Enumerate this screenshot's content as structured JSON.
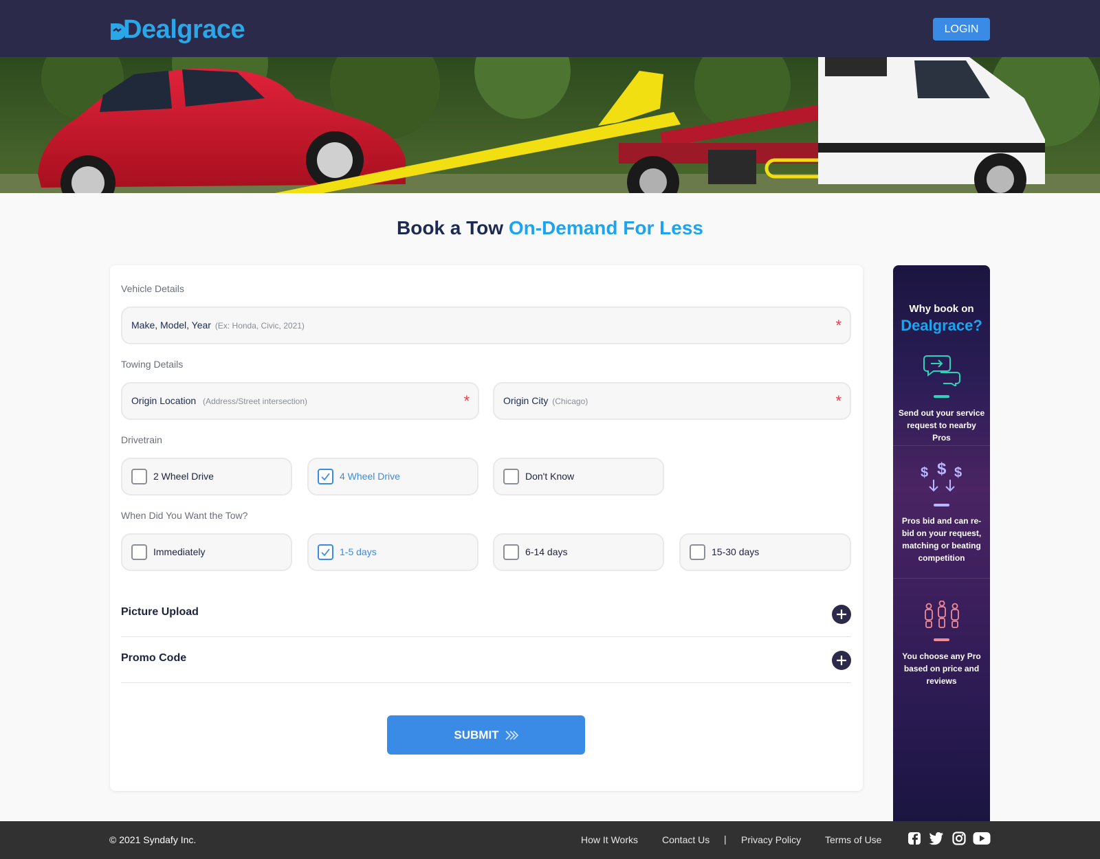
{
  "header": {
    "logo_text": "Dealgrace",
    "login_label": "LOGIN"
  },
  "hero": {
    "image": "tow-truck-loading-red-car"
  },
  "title": {
    "part1": "Book a Tow ",
    "part2": "On-Demand For Less"
  },
  "form": {
    "vehicle_section": "Vehicle Details",
    "vehicle_field": {
      "label": "Make, Model, Year",
      "placeholder": "(Ex: Honda, Civic, 2021)",
      "required": "*"
    },
    "towing_section": "Towing Details",
    "origin_location": {
      "label": "Origin Location",
      "placeholder": "(Address/Street intersection)",
      "required": "*"
    },
    "origin_city": {
      "label": "Origin City",
      "placeholder": "(Chicago)",
      "required": "*"
    },
    "drivetrain_section": "Drivetrain",
    "drivetrain_options": [
      {
        "label": "2 Wheel Drive",
        "checked": false
      },
      {
        "label": "4 Wheel Drive",
        "checked": true
      },
      {
        "label": "Don't Know",
        "checked": false
      }
    ],
    "when_section": "When Did You Want the Tow?",
    "when_options": [
      {
        "label": "Immediately",
        "checked": false
      },
      {
        "label": "1-5 days",
        "checked": true
      },
      {
        "label": "6-14 days",
        "checked": false
      },
      {
        "label": "15-30 days",
        "checked": false
      }
    ],
    "picture_upload": "Picture Upload",
    "promo_code": "Promo Code",
    "submit_label": "SUBMIT"
  },
  "why": {
    "heading1": "Why book on",
    "heading2": "Dealgrace?",
    "steps": [
      {
        "text": "Send out your service request to nearby Pros",
        "icon": "chat-bubbles-icon",
        "color": "#2ed3b7"
      },
      {
        "text": "Pros bid and can re-bid on your request, matching or beating competition",
        "icon": "dollar-bids-icon",
        "color": "#b9b7ff"
      },
      {
        "text": "You choose any Pro based on price and reviews",
        "icon": "choose-pro-icon",
        "color": "#f28b96"
      }
    ]
  },
  "footer": {
    "copyright": "© 2021 Syndafy Inc.",
    "links": [
      "How It Works",
      "Contact Us",
      "Privacy Policy",
      "Terms of Use"
    ],
    "separator": "|",
    "social": [
      "facebook-icon",
      "twitter-icon",
      "instagram-icon",
      "youtube-icon"
    ]
  },
  "colors": {
    "primary": "#3a8be6",
    "accent": "#1ea4ee",
    "header_bg": "#2c2a4a",
    "footer_bg": "#313131"
  }
}
